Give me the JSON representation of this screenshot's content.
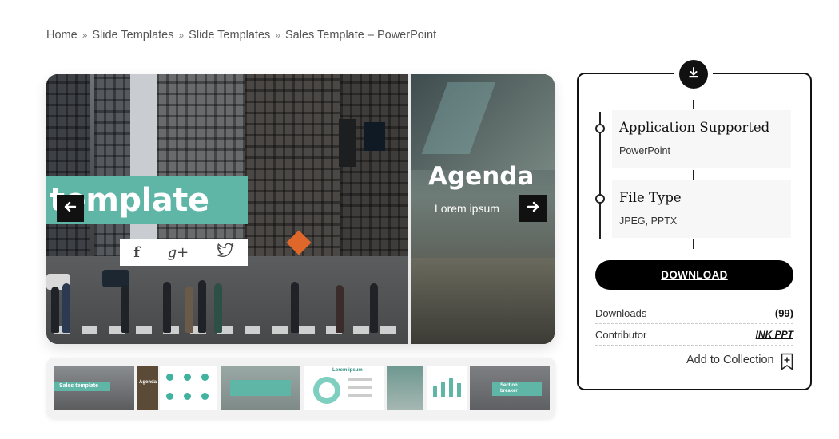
{
  "breadcrumb": {
    "items": [
      "Home",
      "Slide Templates",
      "Slide Templates",
      "Sales Template – PowerPoint"
    ],
    "separator": "»"
  },
  "preview": {
    "slide1_title": "template",
    "slide2_title": "Agenda",
    "slide2_subtitle": "Lorem ipsum",
    "social": {
      "facebook": "f",
      "googleplus": "g+"
    },
    "prev_icon": "arrow-left-icon",
    "next_icon": "arrow-right-icon"
  },
  "thumbnails": [
    {
      "label": "Sales template"
    },
    {
      "label": "Agenda"
    },
    {
      "label": ""
    },
    {
      "label": ""
    },
    {
      "label": "Lorem ipsum"
    },
    {
      "label": ""
    },
    {
      "label": ""
    },
    {
      "label": "Section breaker"
    }
  ],
  "panel": {
    "badge_icon": "download-icon",
    "application": {
      "title": "Application Supported",
      "value": "PowerPoint"
    },
    "filetype": {
      "title": "File Type",
      "value": "JPEG, PPTX"
    },
    "download_label": "DOWNLOAD",
    "downloads": {
      "label": "Downloads",
      "value": "(99)"
    },
    "contributor": {
      "label": "Contributor",
      "value": "INK PPT"
    },
    "collection_label": "Add to Collection",
    "collection_icon": "bookmark-plus-icon"
  },
  "colors": {
    "accent": "#5fb5a6",
    "dark": "#111111"
  }
}
